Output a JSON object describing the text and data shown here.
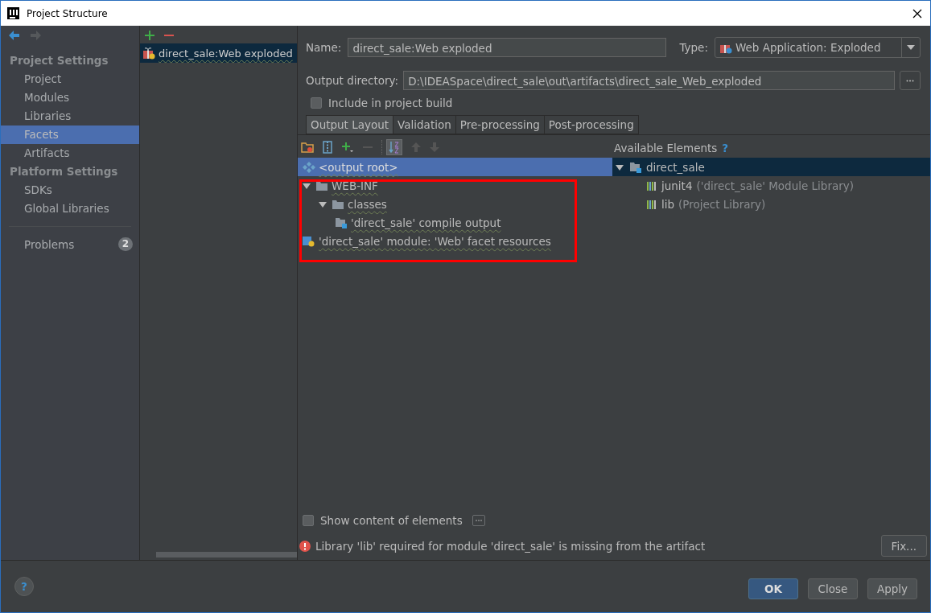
{
  "window": {
    "title": "Project Structure"
  },
  "sidebar": {
    "sections": [
      {
        "heading": "Project Settings",
        "items": [
          {
            "label": "Project",
            "selected": false
          },
          {
            "label": "Modules",
            "selected": false
          },
          {
            "label": "Libraries",
            "selected": false
          },
          {
            "label": "Facets",
            "selected": true
          },
          {
            "label": "Artifacts",
            "selected": false
          }
        ]
      },
      {
        "heading": "Platform Settings",
        "items": [
          {
            "label": "SDKs",
            "selected": false
          },
          {
            "label": "Global Libraries",
            "selected": false
          }
        ]
      }
    ],
    "problems": {
      "label": "Problems",
      "count": "2"
    }
  },
  "artifacts": [
    {
      "label": "direct_sale:Web exploded",
      "selected": true
    }
  ],
  "name_field": {
    "label": "Name:",
    "value": "direct_sale:Web exploded"
  },
  "type_field": {
    "label": "Type:",
    "value": "Web Application: Exploded"
  },
  "output_directory": {
    "label": "Output directory:",
    "value": "D:\\IDEASpace\\direct_sale\\out\\artifacts\\direct_sale_Web_exploded"
  },
  "include_in_build": {
    "label": "Include in project build",
    "checked": false
  },
  "tabs": [
    {
      "label": "Output Layout",
      "selected": true
    },
    {
      "label": "Validation",
      "selected": false
    },
    {
      "label": "Pre-processing",
      "selected": false
    },
    {
      "label": "Post-processing",
      "selected": false
    }
  ],
  "output_tree": [
    {
      "label": "<output root>",
      "kind": "root",
      "selected": true,
      "children": [
        {
          "label": "WEB-INF",
          "kind": "folder",
          "expanded": true,
          "selected": false,
          "children": [
            {
              "label": "classes",
              "kind": "folder",
              "expanded": true,
              "selected": false,
              "children": [
                {
                  "label": "'direct_sale' compile output",
                  "kind": "module-output",
                  "selected": false
                }
              ]
            }
          ]
        },
        {
          "label": "'direct_sale' module: 'Web' facet resources",
          "kind": "facet-resources",
          "selected": false
        }
      ]
    }
  ],
  "available_elements": {
    "title": "Available Elements",
    "help": "?",
    "tree": [
      {
        "label": "direct_sale",
        "kind": "module",
        "expanded": true,
        "selected": true,
        "children": [
          {
            "label": "junit4",
            "note": "('direct_sale' Module Library)",
            "kind": "library",
            "selected": false
          },
          {
            "label": "lib",
            "note": "(Project Library)",
            "kind": "library",
            "selected": false
          }
        ]
      }
    ]
  },
  "show_content": {
    "label": "Show content of elements",
    "checked": false
  },
  "error": {
    "message": "Library 'lib' required for module 'direct_sale' is missing from the artifact",
    "action": "Fix..."
  },
  "help_button": "?",
  "buttons": [
    {
      "label": "OK",
      "kind": "default"
    },
    {
      "label": "Close",
      "kind": "normal"
    },
    {
      "label": "Apply",
      "kind": "normal"
    }
  ]
}
